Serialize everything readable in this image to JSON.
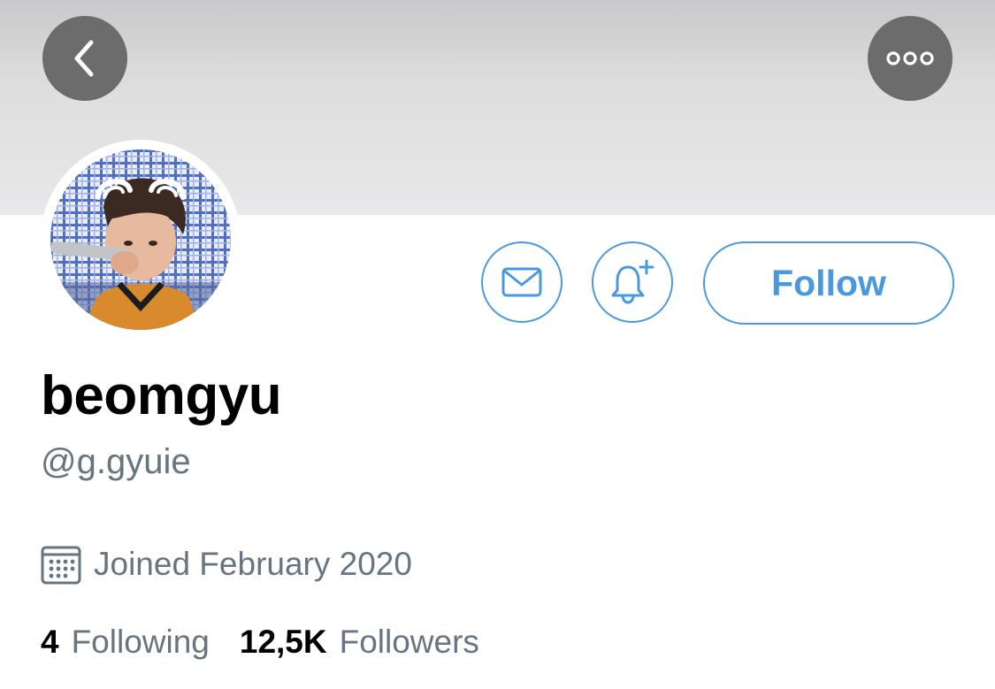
{
  "header": {
    "back_icon": "chevron-left-icon",
    "more_icon": "more-horizontal-icon"
  },
  "profile": {
    "display_name": "beomgyu",
    "handle": "@g.gyuie",
    "joined": "Joined February 2020",
    "joined_icon": "calendar-icon"
  },
  "actions": {
    "message_icon": "envelope-icon",
    "notify_icon": "bell-plus-icon",
    "follow_label": "Follow"
  },
  "stats": {
    "following_count": "4",
    "following_label": "Following",
    "followers_count": "12,5K",
    "followers_label": "Followers"
  },
  "colors": {
    "accent": "#4a99de",
    "secondary_text": "#66757f",
    "overlay_button": "#6c6c6c"
  }
}
